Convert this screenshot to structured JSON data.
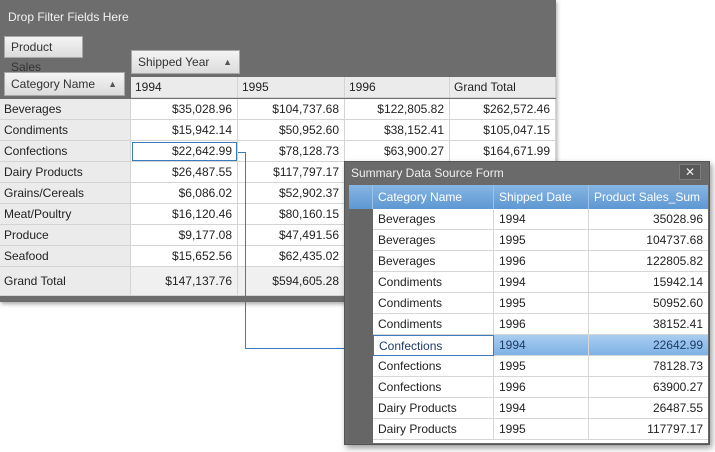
{
  "pivot": {
    "filter_area_label": "Drop Filter Fields Here",
    "data_field": "Product Sales",
    "column_field": "Shipped Year",
    "row_field": "Category Name",
    "column_headers": [
      "1994",
      "1995",
      "1996",
      "Grand Total"
    ],
    "rows": [
      {
        "label": "Beverages",
        "values": [
          "$35,028.96",
          "$104,737.68",
          "$122,805.82",
          "$262,572.46"
        ]
      },
      {
        "label": "Condiments",
        "values": [
          "$15,942.14",
          "$50,952.60",
          "$38,152.41",
          "$105,047.15"
        ]
      },
      {
        "label": "Confections",
        "values": [
          "$22,642.99",
          "$78,128.73",
          "$63,900.27",
          "$164,671.99"
        ]
      },
      {
        "label": "Dairy Products",
        "values": [
          "$26,487.55",
          "$117,797.17",
          "",
          ""
        ]
      },
      {
        "label": "Grains/Cereals",
        "values": [
          "$6,086.02",
          "$52,902.37",
          "",
          ""
        ]
      },
      {
        "label": "Meat/Poultry",
        "values": [
          "$16,120.46",
          "$80,160.15",
          "",
          ""
        ]
      },
      {
        "label": "Produce",
        "values": [
          "$9,177.08",
          "$47,491.56",
          "",
          ""
        ]
      },
      {
        "label": "Seafood",
        "values": [
          "$15,652.56",
          "$62,435.02",
          "",
          ""
        ]
      }
    ],
    "grand_total": {
      "label": "Grand Total",
      "values": [
        "$147,137.76",
        "$594,605.28",
        "",
        ""
      ]
    }
  },
  "form": {
    "title": "Summary Data Source Form",
    "close_glyph": "✕",
    "columns": [
      "Category Name",
      "Shipped Date",
      "Product Sales_Sum"
    ],
    "rows": [
      [
        "Beverages",
        "1994",
        "35028.96"
      ],
      [
        "Beverages",
        "1995",
        "104737.68"
      ],
      [
        "Beverages",
        "1996",
        "122805.82"
      ],
      [
        "Condiments",
        "1994",
        "15942.14"
      ],
      [
        "Condiments",
        "1995",
        "50952.60"
      ],
      [
        "Condiments",
        "1996",
        "38152.41"
      ],
      [
        "Confections",
        "1994",
        "22642.99"
      ],
      [
        "Confections",
        "1995",
        "78128.73"
      ],
      [
        "Confections",
        "1996",
        "63900.27"
      ],
      [
        "Dairy Products",
        "1994",
        "26487.55"
      ],
      [
        "Dairy Products",
        "1995",
        "117797.17"
      ]
    ],
    "selected_row_index": 6
  },
  "colors": {
    "accent": "#3a7bbf",
    "header_blue": "#6fa5dc",
    "panel_gray": "#6d6d6d"
  }
}
